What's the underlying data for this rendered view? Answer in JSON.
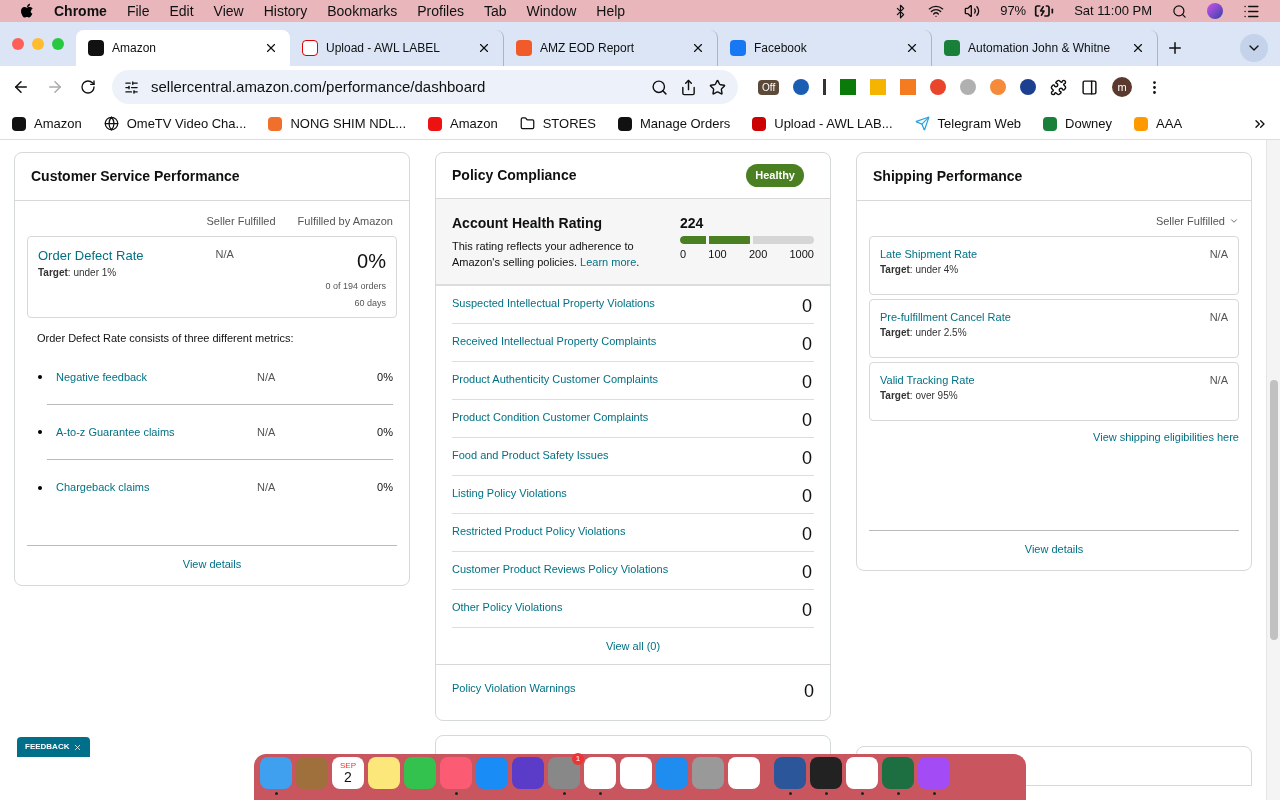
{
  "menubar": {
    "app": "Chrome",
    "menus": [
      "File",
      "Edit",
      "View",
      "History",
      "Bookmarks",
      "Profiles",
      "Tab",
      "Window",
      "Help"
    ],
    "battery": "97%",
    "clock": "Sat 11:00 PM"
  },
  "tabs": [
    {
      "label": "Amazon",
      "selected": true
    },
    {
      "label": "Upload - AWL LABEL",
      "selected": false
    },
    {
      "label": "AMZ EOD Report",
      "selected": false
    },
    {
      "label": "Facebook",
      "selected": false
    },
    {
      "label": "Automation John & Whitne",
      "selected": false
    }
  ],
  "address_bar": {
    "url": "sellercentral.amazon.com/performance/dashboard",
    "extension_badge": "Off",
    "profile": "m"
  },
  "bookmarks": [
    "Amazon",
    "OmeTV Video Cha...",
    "NONG SHIM NDL...",
    "Amazon",
    "STORES",
    "Manage Orders",
    "Upload - AWL LAB...",
    "Telegram Web",
    "Downey",
    "AAA"
  ],
  "customer_service": {
    "title": "Customer Service Performance",
    "columns": [
      "Seller Fulfilled",
      "Fulfilled by Amazon"
    ],
    "odr": {
      "name": "Order Defect Rate",
      "target_label": "Target",
      "target": ": under 1%",
      "seller": "N/A",
      "fba": "0%",
      "orders": "0 of 194 orders",
      "period": "60 days"
    },
    "intro": "Order Defect Rate consists of three different metrics:",
    "metrics": [
      {
        "name": "Negative feedback",
        "seller": "N/A",
        "fba": "0%"
      },
      {
        "name": "A-to-z Guarantee claims",
        "seller": "N/A",
        "fba": "0%"
      },
      {
        "name": "Chargeback claims",
        "seller": "N/A",
        "fba": "0%"
      }
    ],
    "link": "View details"
  },
  "policy": {
    "title": "Policy Compliance",
    "badge": "Healthy",
    "rating_title": "Account Health Rating",
    "rating_text": "This rating reflects your adherence to Amazon's selling policies.",
    "learn_more": "Learn more",
    "rating_text_end": ".",
    "score": "224",
    "level": 0.54,
    "ticks": [
      "0",
      "100",
      "200",
      "1000"
    ],
    "rows": [
      {
        "label": "Suspected Intellectual Property Violations",
        "count": "0"
      },
      {
        "label": "Received Intellectual Property Complaints",
        "count": "0"
      },
      {
        "label": "Product Authenticity Customer Complaints",
        "count": "0"
      },
      {
        "label": "Product Condition Customer Complaints",
        "count": "0"
      },
      {
        "label": "Food and Product Safety Issues",
        "count": "0"
      },
      {
        "label": "Listing Policy Violations",
        "count": "0"
      },
      {
        "label": "Restricted Product Policy Violations",
        "count": "0"
      },
      {
        "label": "Customer Product Reviews Policy Violations",
        "count": "0"
      },
      {
        "label": "Other Policy Violations",
        "count": "0"
      }
    ],
    "view_all": "View all (0)",
    "warnings": {
      "label": "Policy Violation Warnings",
      "count": "0"
    }
  },
  "shipping": {
    "title": "Shipping Performance",
    "filter": "Seller Fulfilled",
    "metrics": [
      {
        "name": "Late Shipment Rate",
        "target_label": "Target",
        "target": ": under 4%",
        "value": "N/A"
      },
      {
        "name": "Pre-fulfillment Cancel Rate",
        "target_label": "Target",
        "target": ": under 2.5%",
        "value": "N/A"
      },
      {
        "name": "Valid Tracking Rate",
        "target_label": "Target",
        "target": ": over 95%",
        "value": "N/A"
      }
    ],
    "eligibility_link": "View shipping eligibilities here",
    "link": "View details"
  },
  "feedback": "FEEDBACK",
  "dock": {
    "calendar_month": "SEP",
    "calendar_day": "2",
    "settings_badge": "1",
    "items": [
      {
        "running": true
      },
      {
        "running": false
      },
      {
        "running": false
      },
      {
        "running": false
      },
      {
        "running": false
      },
      {
        "running": true
      },
      {
        "running": false
      },
      {
        "running": false
      },
      {
        "running": true
      },
      {
        "running": true
      },
      {
        "running": false
      },
      {
        "running": false
      },
      {
        "running": false
      },
      {
        "running": false
      },
      {
        "running": true
      },
      {
        "running": true
      },
      {
        "running": true
      },
      {
        "running": true
      },
      {
        "running": true
      }
    ]
  }
}
